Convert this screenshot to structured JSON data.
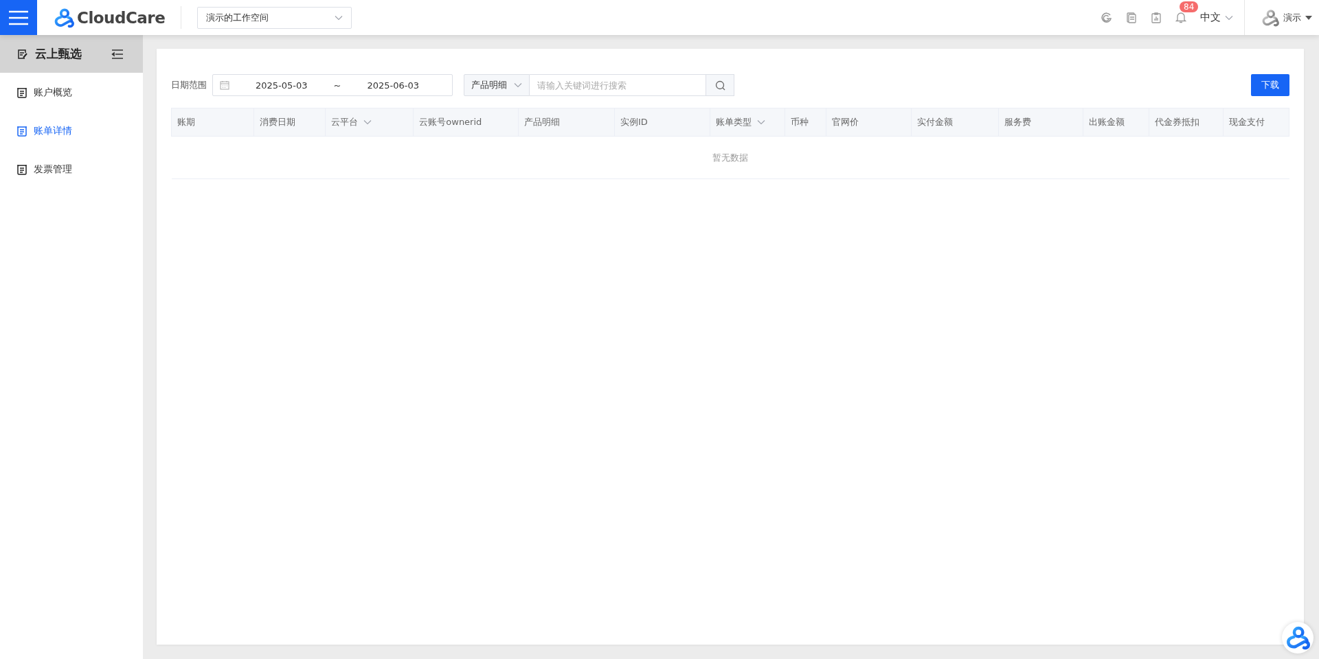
{
  "header": {
    "logo_text": "CloudCare",
    "workspace": "演示的工作空间",
    "notification_count": "84",
    "language": "中文",
    "user": "演示"
  },
  "sidebar": {
    "title": "云上甄选",
    "items": [
      {
        "label": "账户概览",
        "selected": false
      },
      {
        "label": "账单详情",
        "selected": true
      },
      {
        "label": "发票管理",
        "selected": false
      }
    ]
  },
  "filters": {
    "date_label": "日期范围",
    "start_date": "2025-05-03",
    "separator": "~",
    "end_date": "2025-06-03",
    "field": "产品明细",
    "placeholder": "请输入关键词进行搜索",
    "download": "下载"
  },
  "table": {
    "columns": [
      {
        "label": "账期",
        "filter": false
      },
      {
        "label": "消费日期",
        "filter": false
      },
      {
        "label": "云平台",
        "filter": true
      },
      {
        "label": "云账号ownerid",
        "filter": false
      },
      {
        "label": "产品明细",
        "filter": false
      },
      {
        "label": "实例ID",
        "filter": false
      },
      {
        "label": "账单类型",
        "filter": true
      },
      {
        "label": "币种",
        "filter": false
      },
      {
        "label": "官网价",
        "filter": false
      },
      {
        "label": "实付金额",
        "filter": false
      },
      {
        "label": "服务费",
        "filter": false
      },
      {
        "label": "出账金额",
        "filter": false
      },
      {
        "label": "代金券抵扣",
        "filter": false
      },
      {
        "label": "现金支付",
        "filter": false
      }
    ],
    "empty_text": "暂无数据"
  }
}
